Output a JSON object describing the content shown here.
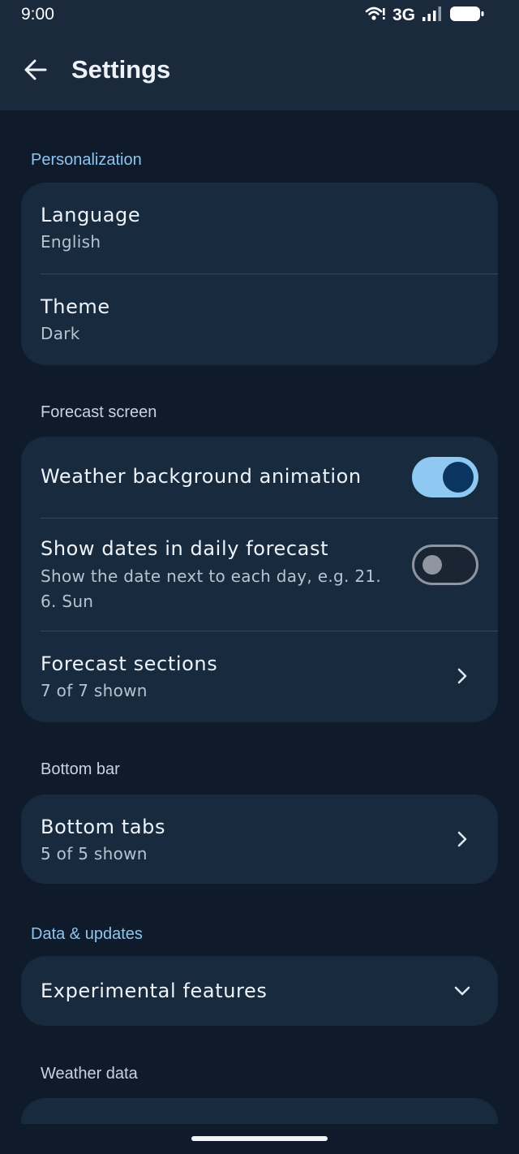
{
  "status_bar": {
    "time": "9:00",
    "network": "3G"
  },
  "app_bar": {
    "title": "Settings"
  },
  "sections": {
    "personalization": "Personalization",
    "forecast_screen": "Forecast screen",
    "bottom_bar": "Bottom bar",
    "data_updates": "Data & updates",
    "weather_data": "Weather data"
  },
  "personalization": {
    "language_title": "Language",
    "language_value": "English",
    "theme_title": "Theme",
    "theme_value": "Dark"
  },
  "forecast": {
    "animation_title": "Weather background animation",
    "animation_enabled": true,
    "dates_title": "Show dates in daily forecast",
    "dates_desc": "Show the date next to each day, e.g. 21. 6. Sun",
    "dates_enabled": false,
    "sections_title": "Forecast sections",
    "sections_value": "7 of 7 shown"
  },
  "bottom_bar": {
    "tabs_title": "Bottom tabs",
    "tabs_value": "5 of 5 shown"
  },
  "data_updates": {
    "experimental_title": "Experimental features"
  },
  "colors": {
    "background": "#0f1b2b",
    "card": "#182a3e",
    "accent": "#8fc4ee",
    "toggle_on": "#8fc8f2",
    "toggle_knob_on": "#0b3561"
  },
  "icons": [
    "wifi-icon",
    "signal-icon",
    "battery-icon",
    "back-arrow-icon",
    "chevron-right-icon",
    "chevron-down-icon"
  ]
}
